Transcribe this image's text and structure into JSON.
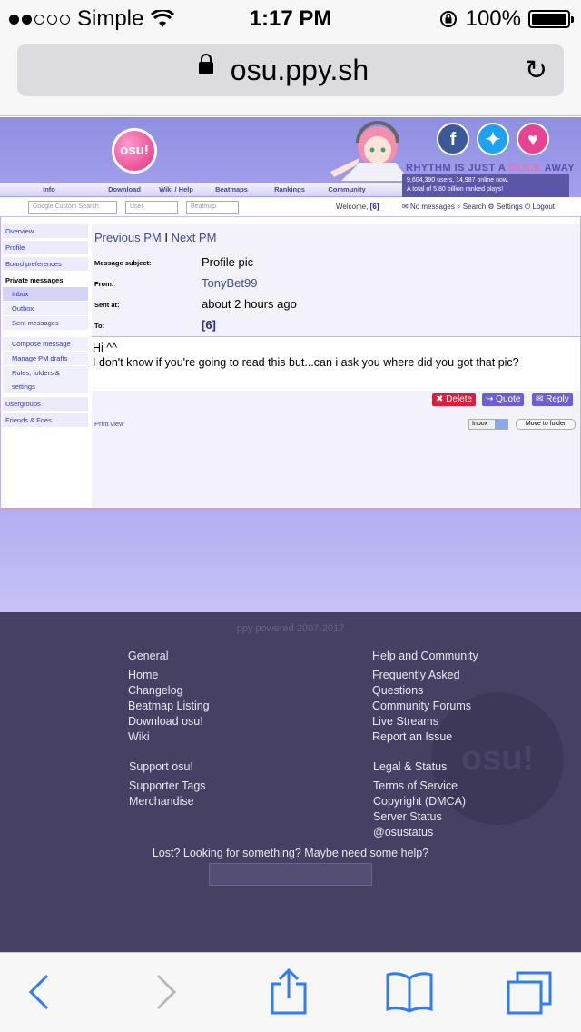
{
  "status_bar": {
    "carrier": "Simple",
    "time": "1:17 PM",
    "battery": "100%"
  },
  "browser": {
    "url": "osu.ppy.sh"
  },
  "site": {
    "logo_text": "osu!",
    "tagline_pre": "RHYTHM IS JUST A ",
    "tagline_click": "CLICK",
    "tagline_post": " AWAY",
    "stats_line1": "9,604,390 users, 14,987 online now.",
    "stats_line2": "A total of 5.80 billion ranked plays!",
    "nav": [
      "Info",
      "Download",
      "Wiki / Help",
      "Beatmaps",
      "Rankings",
      "Community"
    ],
    "search_placeholder": "Google Custom Search",
    "user_placeholder": "User",
    "beatmap_placeholder": "Beatmap",
    "welcome": "Welcome,",
    "welcome_user": "[6]",
    "links": [
      "No messages",
      "Search",
      "Settings",
      "Logout"
    ]
  },
  "sidebar": {
    "items": [
      "Overview",
      "Profile",
      "Board preferences"
    ],
    "private_messages": "Private messages",
    "pm_items": [
      "Inbox",
      "Outbox",
      "Sent messages",
      "Compose message",
      "Manage PM drafts",
      "Rules, folders &",
      "settings"
    ],
    "bottom_items": [
      "Usergroups",
      "Friends & Foes"
    ]
  },
  "message": {
    "prev": "Previous PM",
    "sep": "I",
    "next": "Next PM",
    "subject_label": "Message subject:",
    "subject": "Profile pic",
    "from_label": "From:",
    "from": "TonyBet99",
    "sent_label": "Sent at:",
    "sent": "about 2 hours ago",
    "to_label": "To:",
    "to": "[6]",
    "body_line1": "Hi ^^",
    "body_line2": "I don't know if you're going to read this but...can i ask you where did you got that pic?",
    "delete": "Delete",
    "quote": "Quote",
    "reply": "Reply",
    "print": "Print view",
    "folder": "Inbox",
    "move": "Move to folder"
  },
  "footer": {
    "powered": "ppy powered 2007-2017",
    "general_title": "General",
    "general": [
      "Home",
      "Changelog",
      "Beatmap Listing",
      "Download osu!",
      "Wiki"
    ],
    "help_title": "Help and Community",
    "help": [
      "Frequently Asked",
      "Questions",
      "Community Forums",
      "Live Streams",
      "Report an Issue"
    ],
    "support_title": "Support osu!",
    "support": [
      "Supporter Tags",
      "Merchandise"
    ],
    "legal_title": "Legal & Status",
    "legal": [
      "Terms of Service",
      "Copyright (DMCA)",
      "Server Status",
      "@osustatus"
    ],
    "lost": "Lost? Looking for something? Maybe need some help?",
    "watermark": "osu!"
  },
  "colors": {
    "accent": "#2f7cf6",
    "header": "#a4a0ee",
    "footer": "#464062"
  }
}
